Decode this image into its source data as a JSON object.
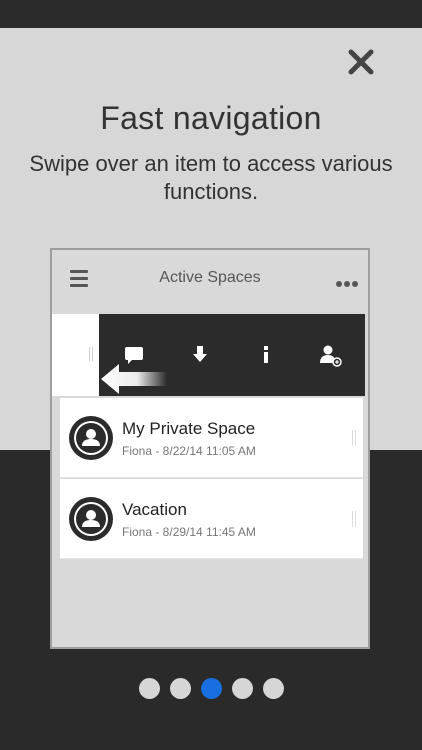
{
  "onboarding": {
    "title": "Fast navigation",
    "subtitle": "Swipe over an item to access various functions.",
    "close_icon": "close-icon"
  },
  "phone": {
    "header": {
      "title": "Active Spaces",
      "menu_icon": "hamburger-menu-icon",
      "more_icon": "more-dots-icon"
    },
    "swipe_actions": [
      {
        "icon": "comment-icon"
      },
      {
        "icon": "download-icon"
      },
      {
        "icon": "info-icon"
      },
      {
        "icon": "add-user-icon"
      }
    ],
    "list": [
      {
        "title": "My Private Space",
        "meta": "Fiona - 8/22/14 11:05 AM"
      },
      {
        "title": "Vacation",
        "meta": "Fiona - 8/29/14 11:45 AM"
      }
    ]
  },
  "pager": {
    "count": 5,
    "active_index": 2
  },
  "colors": {
    "accent": "#1a6fe0",
    "light_bg": "#d7d7d7",
    "dark_bg": "#2a2a2a"
  }
}
